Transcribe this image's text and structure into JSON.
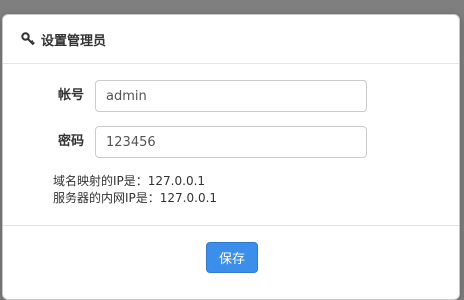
{
  "dialog": {
    "title": "设置管理员",
    "title_icon": "key-icon"
  },
  "form": {
    "account_label": "帐号",
    "account_value": "admin",
    "password_label": "密码",
    "password_value": "123456"
  },
  "info": {
    "domain_ip_line": "域名映射的IP是：127.0.0.1",
    "lan_ip_line": "服务器的内网IP是：127.0.0.1"
  },
  "footer": {
    "save_label": "保存"
  },
  "colors": {
    "primary_button": "#3b8eea",
    "overlay": "#7f7f7f"
  }
}
